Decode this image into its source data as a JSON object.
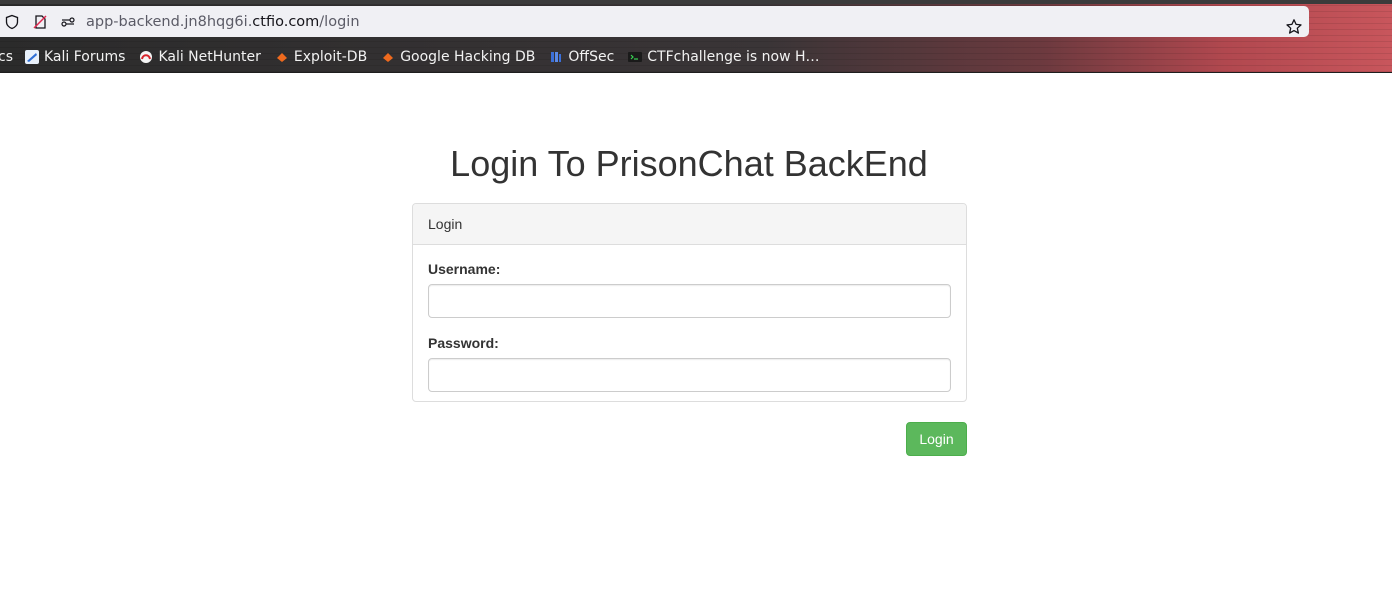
{
  "browser": {
    "url_prefix": "app-backend.jn8hqg6i.",
    "url_host": "ctfio.com",
    "url_path": "/login",
    "bookmarks": [
      {
        "label": "cs"
      },
      {
        "label": "Kali Forums",
        "icon": "kali-dragon-icon"
      },
      {
        "label": "Kali NetHunter",
        "icon": "nethunter-icon"
      },
      {
        "label": "Exploit-DB",
        "icon": "exploitdb-icon"
      },
      {
        "label": "Google Hacking DB",
        "icon": "ghdb-icon"
      },
      {
        "label": "OffSec",
        "icon": "offsec-icon"
      },
      {
        "label": "CTFchallenge is now H…",
        "icon": "terminal-icon"
      }
    ]
  },
  "page": {
    "title": "Login To PrisonChat BackEnd",
    "panel_heading": "Login",
    "username_label": "Username:",
    "username_value": "",
    "password_label": "Password:",
    "password_value": "",
    "submit_label": "Login"
  },
  "colors": {
    "primary_button": "#5cb85c",
    "panel_heading_bg": "#f5f5f5"
  }
}
